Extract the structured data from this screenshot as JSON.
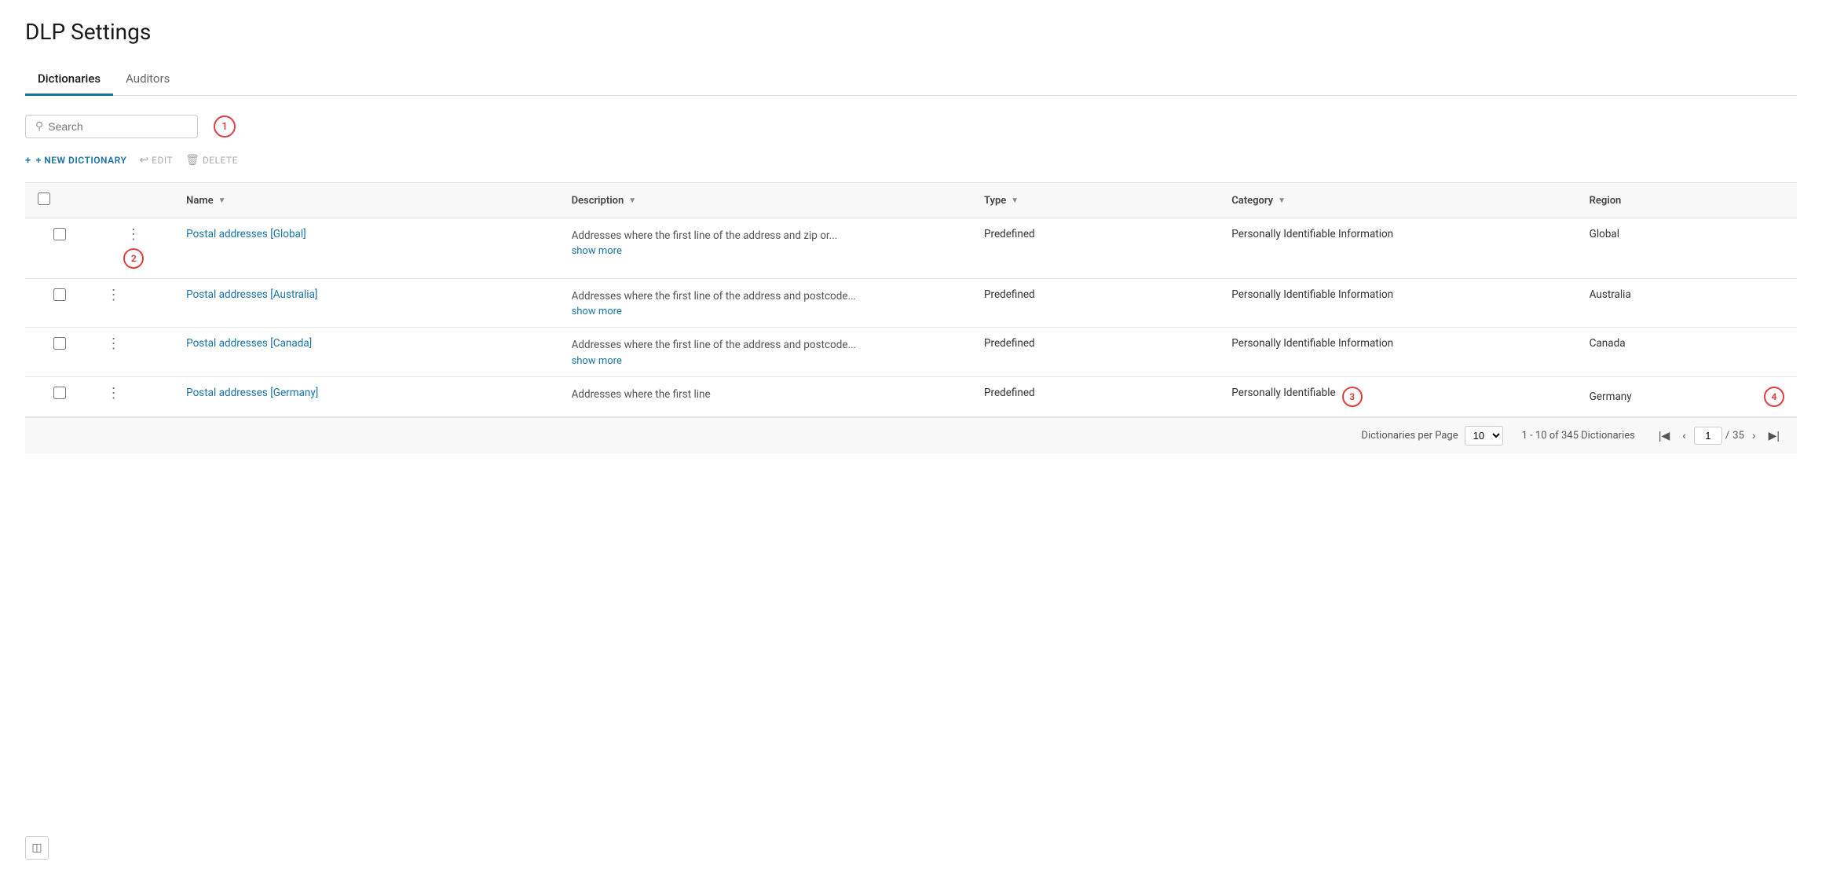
{
  "page": {
    "title": "DLP Settings"
  },
  "tabs": [
    {
      "id": "dictionaries",
      "label": "Dictionaries",
      "active": true
    },
    {
      "id": "auditors",
      "label": "Auditors",
      "active": false
    }
  ],
  "search": {
    "placeholder": "Search"
  },
  "step_badges": {
    "badge1": "1",
    "badge2": "2",
    "badge3": "3",
    "badge4": "4"
  },
  "actions": {
    "new_dictionary": "+ NEW DICTIONARY",
    "edit": "EDIT",
    "delete": "DELETE"
  },
  "table": {
    "columns": [
      {
        "id": "name",
        "label": "Name"
      },
      {
        "id": "description",
        "label": "Description"
      },
      {
        "id": "type",
        "label": "Type"
      },
      {
        "id": "category",
        "label": "Category"
      },
      {
        "id": "region",
        "label": "Region"
      }
    ],
    "rows": [
      {
        "id": 1,
        "name": "Postal addresses [Global]",
        "description": "Addresses where the first line of the address and zip or...",
        "show_more": "show more",
        "type": "Predefined",
        "category": "Personally Identifiable Information",
        "region": "Global",
        "has_badge": true
      },
      {
        "id": 2,
        "name": "Postal addresses [Australia]",
        "description": "Addresses where the first line of the address and postcode...",
        "show_more": "show more",
        "type": "Predefined",
        "category": "Personally Identifiable Information",
        "region": "Australia",
        "has_badge": false
      },
      {
        "id": 3,
        "name": "Postal addresses [Canada]",
        "description": "Addresses where the first line of the address and postcode...",
        "show_more": "show more",
        "type": "Predefined",
        "category": "Personally Identifiable Information",
        "region": "Canada",
        "has_badge": false
      },
      {
        "id": 4,
        "name": "Postal addresses [Germany]",
        "description": "Addresses where the first line",
        "show_more": "",
        "type": "Predefined",
        "category": "Personally Identifiable",
        "region": "Germany",
        "has_badge": false
      }
    ]
  },
  "footer": {
    "per_page_label": "Dictionaries per Page",
    "per_page_value": "10",
    "pagination_info": "1 - 10 of 345 Dictionaries",
    "current_page": "1",
    "total_pages": "35",
    "page_separator": "/"
  }
}
